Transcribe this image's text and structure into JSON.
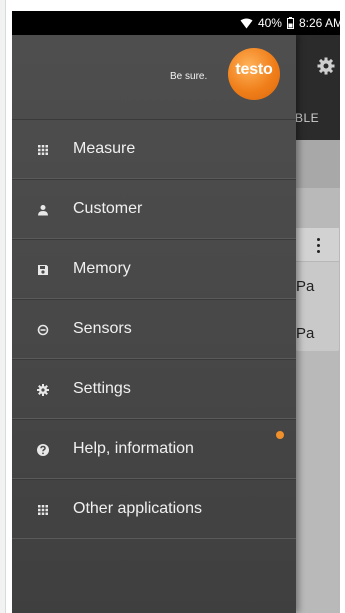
{
  "status_bar": {
    "battery": "40%",
    "time": "8:26 AM",
    "icons": [
      "wifi-icon",
      "battery-icon"
    ]
  },
  "brand": {
    "tagline": "Be sure.",
    "logo_text": "testo",
    "logo_color": "#f07f1a"
  },
  "background_app": {
    "tab_fragment": "BLE",
    "values": [
      "Pa",
      "Pa"
    ]
  },
  "menu": [
    {
      "label": "Measure",
      "icon": "grid-icon"
    },
    {
      "label": "Customer",
      "icon": "person-icon"
    },
    {
      "label": "Memory",
      "icon": "save-icon"
    },
    {
      "label": "Sensors",
      "icon": "sensor-icon"
    },
    {
      "label": "Settings",
      "icon": "gear-icon"
    },
    {
      "label": "Help, information",
      "icon": "help-icon",
      "notification": true
    },
    {
      "label": "Other applications",
      "icon": "apps-grid-icon"
    }
  ],
  "colors": {
    "drawer_bg": "#4a4a4a",
    "notification_dot": "#f0902a"
  }
}
